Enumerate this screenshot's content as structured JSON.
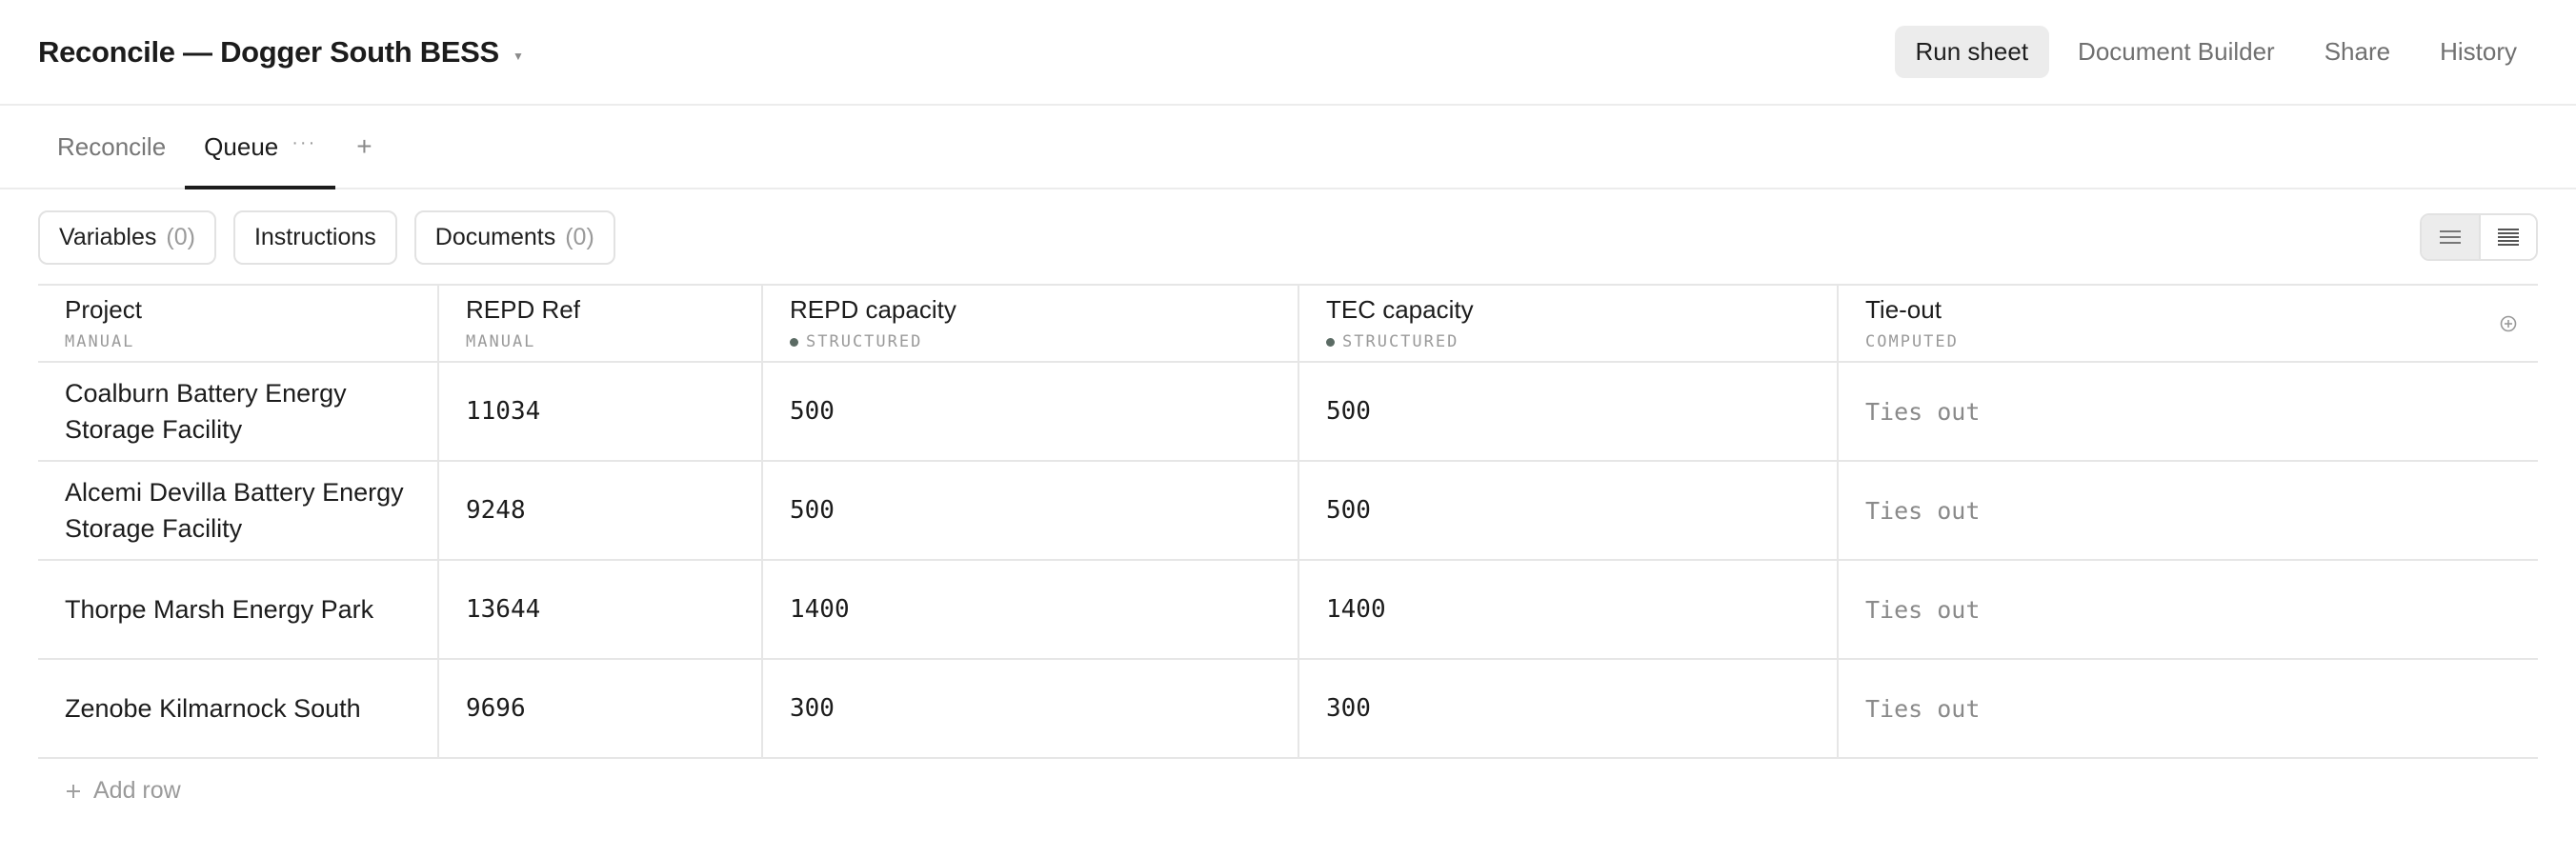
{
  "header": {
    "title": "Reconcile — Dogger South BESS",
    "actions": {
      "run": "Run sheet",
      "builder": "Document Builder",
      "share": "Share",
      "history": "History"
    }
  },
  "tabs": {
    "reconcile": "Reconcile",
    "queue": "Queue",
    "more": "···",
    "add": "+"
  },
  "toolbar": {
    "variables": {
      "label": "Variables",
      "count": "(0)"
    },
    "instructions": {
      "label": "Instructions"
    },
    "documents": {
      "label": "Documents",
      "count": "(0)"
    }
  },
  "table": {
    "columns": [
      {
        "label": "Project",
        "sub": "MANUAL"
      },
      {
        "label": "REPD Ref",
        "sub": "MANUAL"
      },
      {
        "label": "REPD capacity",
        "sub": "STRUCTURED"
      },
      {
        "label": "TEC capacity",
        "sub": "STRUCTURED"
      },
      {
        "label": "Tie-out",
        "sub": "COMPUTED"
      }
    ],
    "rows": [
      {
        "project_l1": "Coalburn Battery Energy",
        "project_l2": "Storage Facility",
        "ref": "11034",
        "repd": "500",
        "tec": "500",
        "tie": "Ties out"
      },
      {
        "project_l1": "Alcemi Devilla Battery Energy",
        "project_l2": "Storage Facility",
        "ref": "9248",
        "repd": "500",
        "tec": "500",
        "tie": "Ties out"
      },
      {
        "project_l1": "Thorpe Marsh Energy Park",
        "project_l2": "",
        "ref": "13644",
        "repd": "1400",
        "tec": "1400",
        "tie": "Ties out"
      },
      {
        "project_l1": "Zenobe Kilmarnock South",
        "project_l2": "",
        "ref": "9696",
        "repd": "300",
        "tec": "300",
        "tie": "Ties out"
      }
    ],
    "add_row": "Add row"
  },
  "colors": {
    "accent": "#1c1c1c",
    "structured_dot": "#5b6b64",
    "border": "#e6e6e6"
  }
}
